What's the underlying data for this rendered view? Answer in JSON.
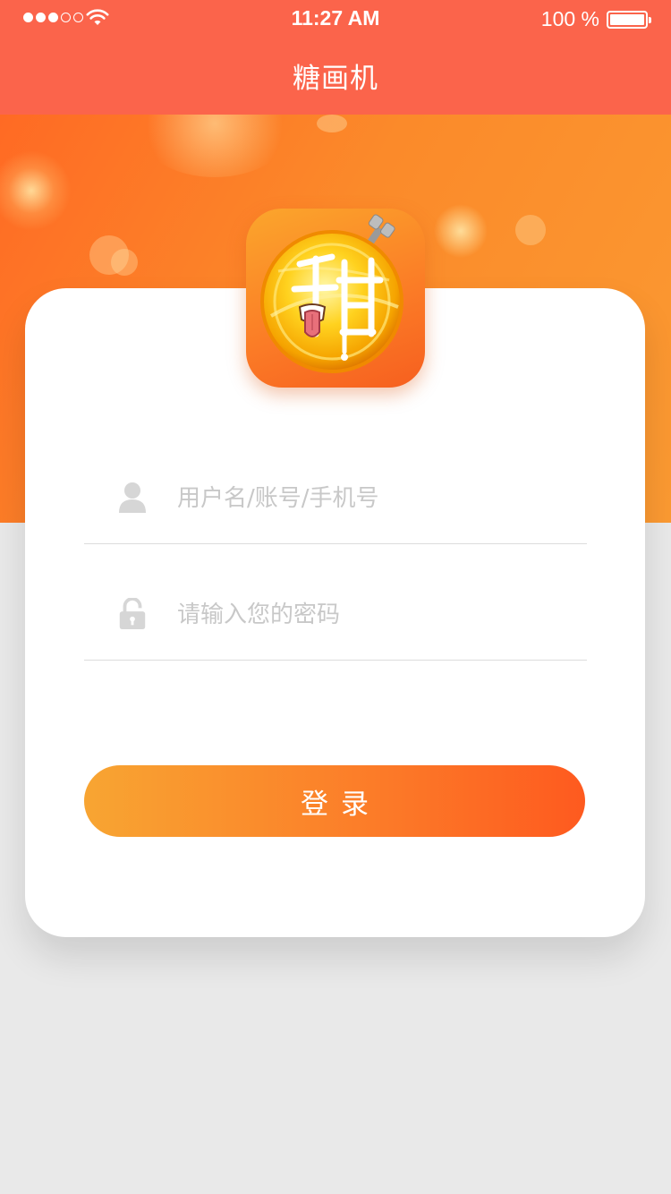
{
  "status_bar": {
    "time": "11:27 AM",
    "battery_text": "100 %",
    "signal_bars_filled": 3,
    "signal_bars_total": 5
  },
  "nav": {
    "title": "糖画机"
  },
  "app_icon": {
    "glyph": "甜"
  },
  "form": {
    "username": {
      "placeholder": "用户名/账号/手机号",
      "value": "",
      "icon": "user-icon"
    },
    "password": {
      "placeholder": "请输入您的密码",
      "value": "",
      "icon": "lock-icon"
    },
    "login_label": "登录"
  },
  "colors": {
    "nav_bar": "#fb644b",
    "hero_start": "#ff6a24",
    "hero_end": "#fb9a32",
    "button_start": "#f8a532",
    "button_end": "#fe5a1f",
    "placeholder": "#c8c8c8",
    "background": "#e9e9e9"
  }
}
